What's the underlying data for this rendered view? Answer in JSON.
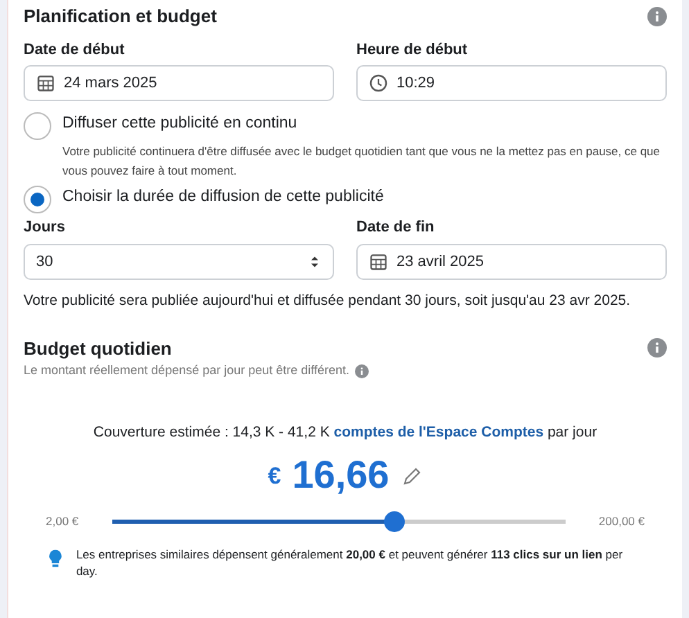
{
  "section": {
    "title": "Planification et budget"
  },
  "start_date": {
    "label": "Date de début",
    "value": "24 mars 2025"
  },
  "start_time": {
    "label": "Heure de début",
    "value": "10:29"
  },
  "options": [
    {
      "label": "Diffuser cette publicité en continu",
      "description": "Votre publicité continuera d'être diffusée avec le budget quotidien tant que vous ne la mettez pas en pause, ce que vous pouvez faire à tout moment.",
      "selected": false
    },
    {
      "label": "Choisir la durée de diffusion de cette publicité",
      "selected": true
    }
  ],
  "days": {
    "label": "Jours",
    "value": "30"
  },
  "end_date": {
    "label": "Date de fin",
    "value": "23 avril 2025"
  },
  "summary": "Votre publicité sera publiée aujourd'hui et diffusée pendant 30 jours, soit jusqu'au 23 avr 2025.",
  "budget": {
    "title": "Budget quotidien",
    "subtitle": "Le montant réellement dépensé par jour peut être différent.",
    "coverage_prefix": "Couverture estimée : 14,3 K - 41,2 K",
    "coverage_link": "comptes de l'Espace Comptes",
    "coverage_suffix": "par jour",
    "currency": "€",
    "amount": "16,66",
    "min": "2,00 €",
    "max": "200,00 €",
    "level": 0.62,
    "tip": "Les entreprises similaires dépensent généralement **20,00 €** et peuvent générer **113 clics sur un lien** per day."
  }
}
